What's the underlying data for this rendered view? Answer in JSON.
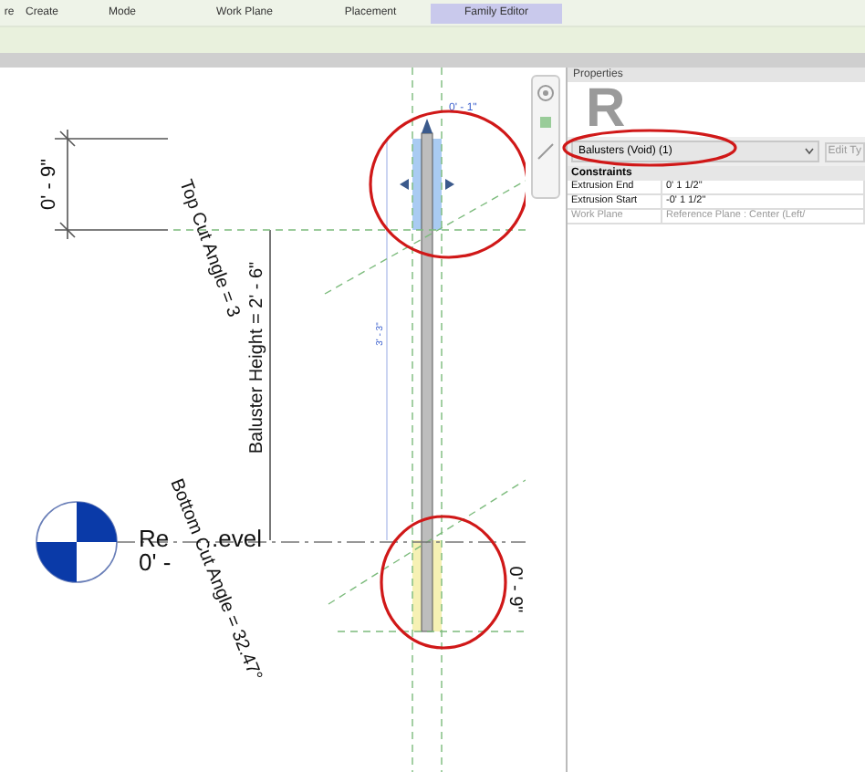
{
  "ribbon": {
    "panels": [
      {
        "label": "re",
        "highlighted": false
      },
      {
        "label": "Create",
        "highlighted": false
      },
      {
        "label": "Mode",
        "highlighted": false
      },
      {
        "label": "Work Plane",
        "highlighted": false
      },
      {
        "label": "Placement",
        "highlighted": false
      },
      {
        "label": "Family Editor",
        "highlighted": true
      }
    ]
  },
  "canvas": {
    "labels": [
      {
        "kind": "dimension",
        "text": "0' - 9\""
      },
      {
        "kind": "parameter",
        "text": "Top Cut Angle = 3"
      },
      {
        "kind": "parameter",
        "text": "Baluster Height = 2' - 6\""
      },
      {
        "kind": "small",
        "text": "3' - 3\""
      },
      {
        "kind": "small",
        "text": "0' - 1\""
      },
      {
        "kind": "level",
        "text": "Re"
      },
      {
        "kind": "level",
        "text": ".evel"
      },
      {
        "kind": "level",
        "text": "0' -"
      },
      {
        "kind": "parameter",
        "text": "Bottom Cut Angle = 32.47°"
      },
      {
        "kind": "dimension",
        "text": "0' - 9\""
      }
    ]
  },
  "properties": {
    "title": "Properties",
    "logo": "R",
    "type_selector": "Balusters (Void) (1)",
    "edit_type": "Edit Ty",
    "group": "Constraints",
    "rows": [
      {
        "name": "Extrusion End",
        "value": "0' 1 1/2\"",
        "disabled": false
      },
      {
        "name": "Extrusion Start",
        "value": "-0' 1 1/2\"",
        "disabled": false
      },
      {
        "name": "Work Plane",
        "value": "Reference Plane : Center (Left/",
        "disabled": true
      }
    ]
  }
}
